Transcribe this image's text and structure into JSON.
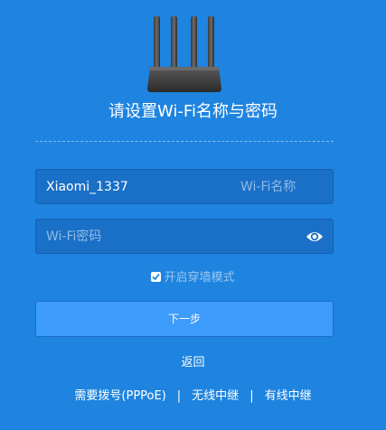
{
  "page": {
    "title": "请设置Wi-Fi名称与密码",
    "router_icon": "router-icon",
    "background_color": "#1e84e0"
  },
  "ssid": {
    "value": "Xiaomi_1337",
    "hint": "Wi-Fi名称"
  },
  "password": {
    "value": "",
    "placeholder": "Wi-Fi密码",
    "toggle_icon": "eye-icon"
  },
  "wall_mode": {
    "label": "开启穿墙模式",
    "checked": true
  },
  "next_button": {
    "label": "下一步",
    "color": "#3d9bfb"
  },
  "back_link": {
    "label": "返回"
  },
  "bottom_links": {
    "pppoe": "需要拨号(PPPoE)",
    "wireless_relay": "无线中继",
    "wired_relay": "有线中继",
    "separator": "|"
  }
}
